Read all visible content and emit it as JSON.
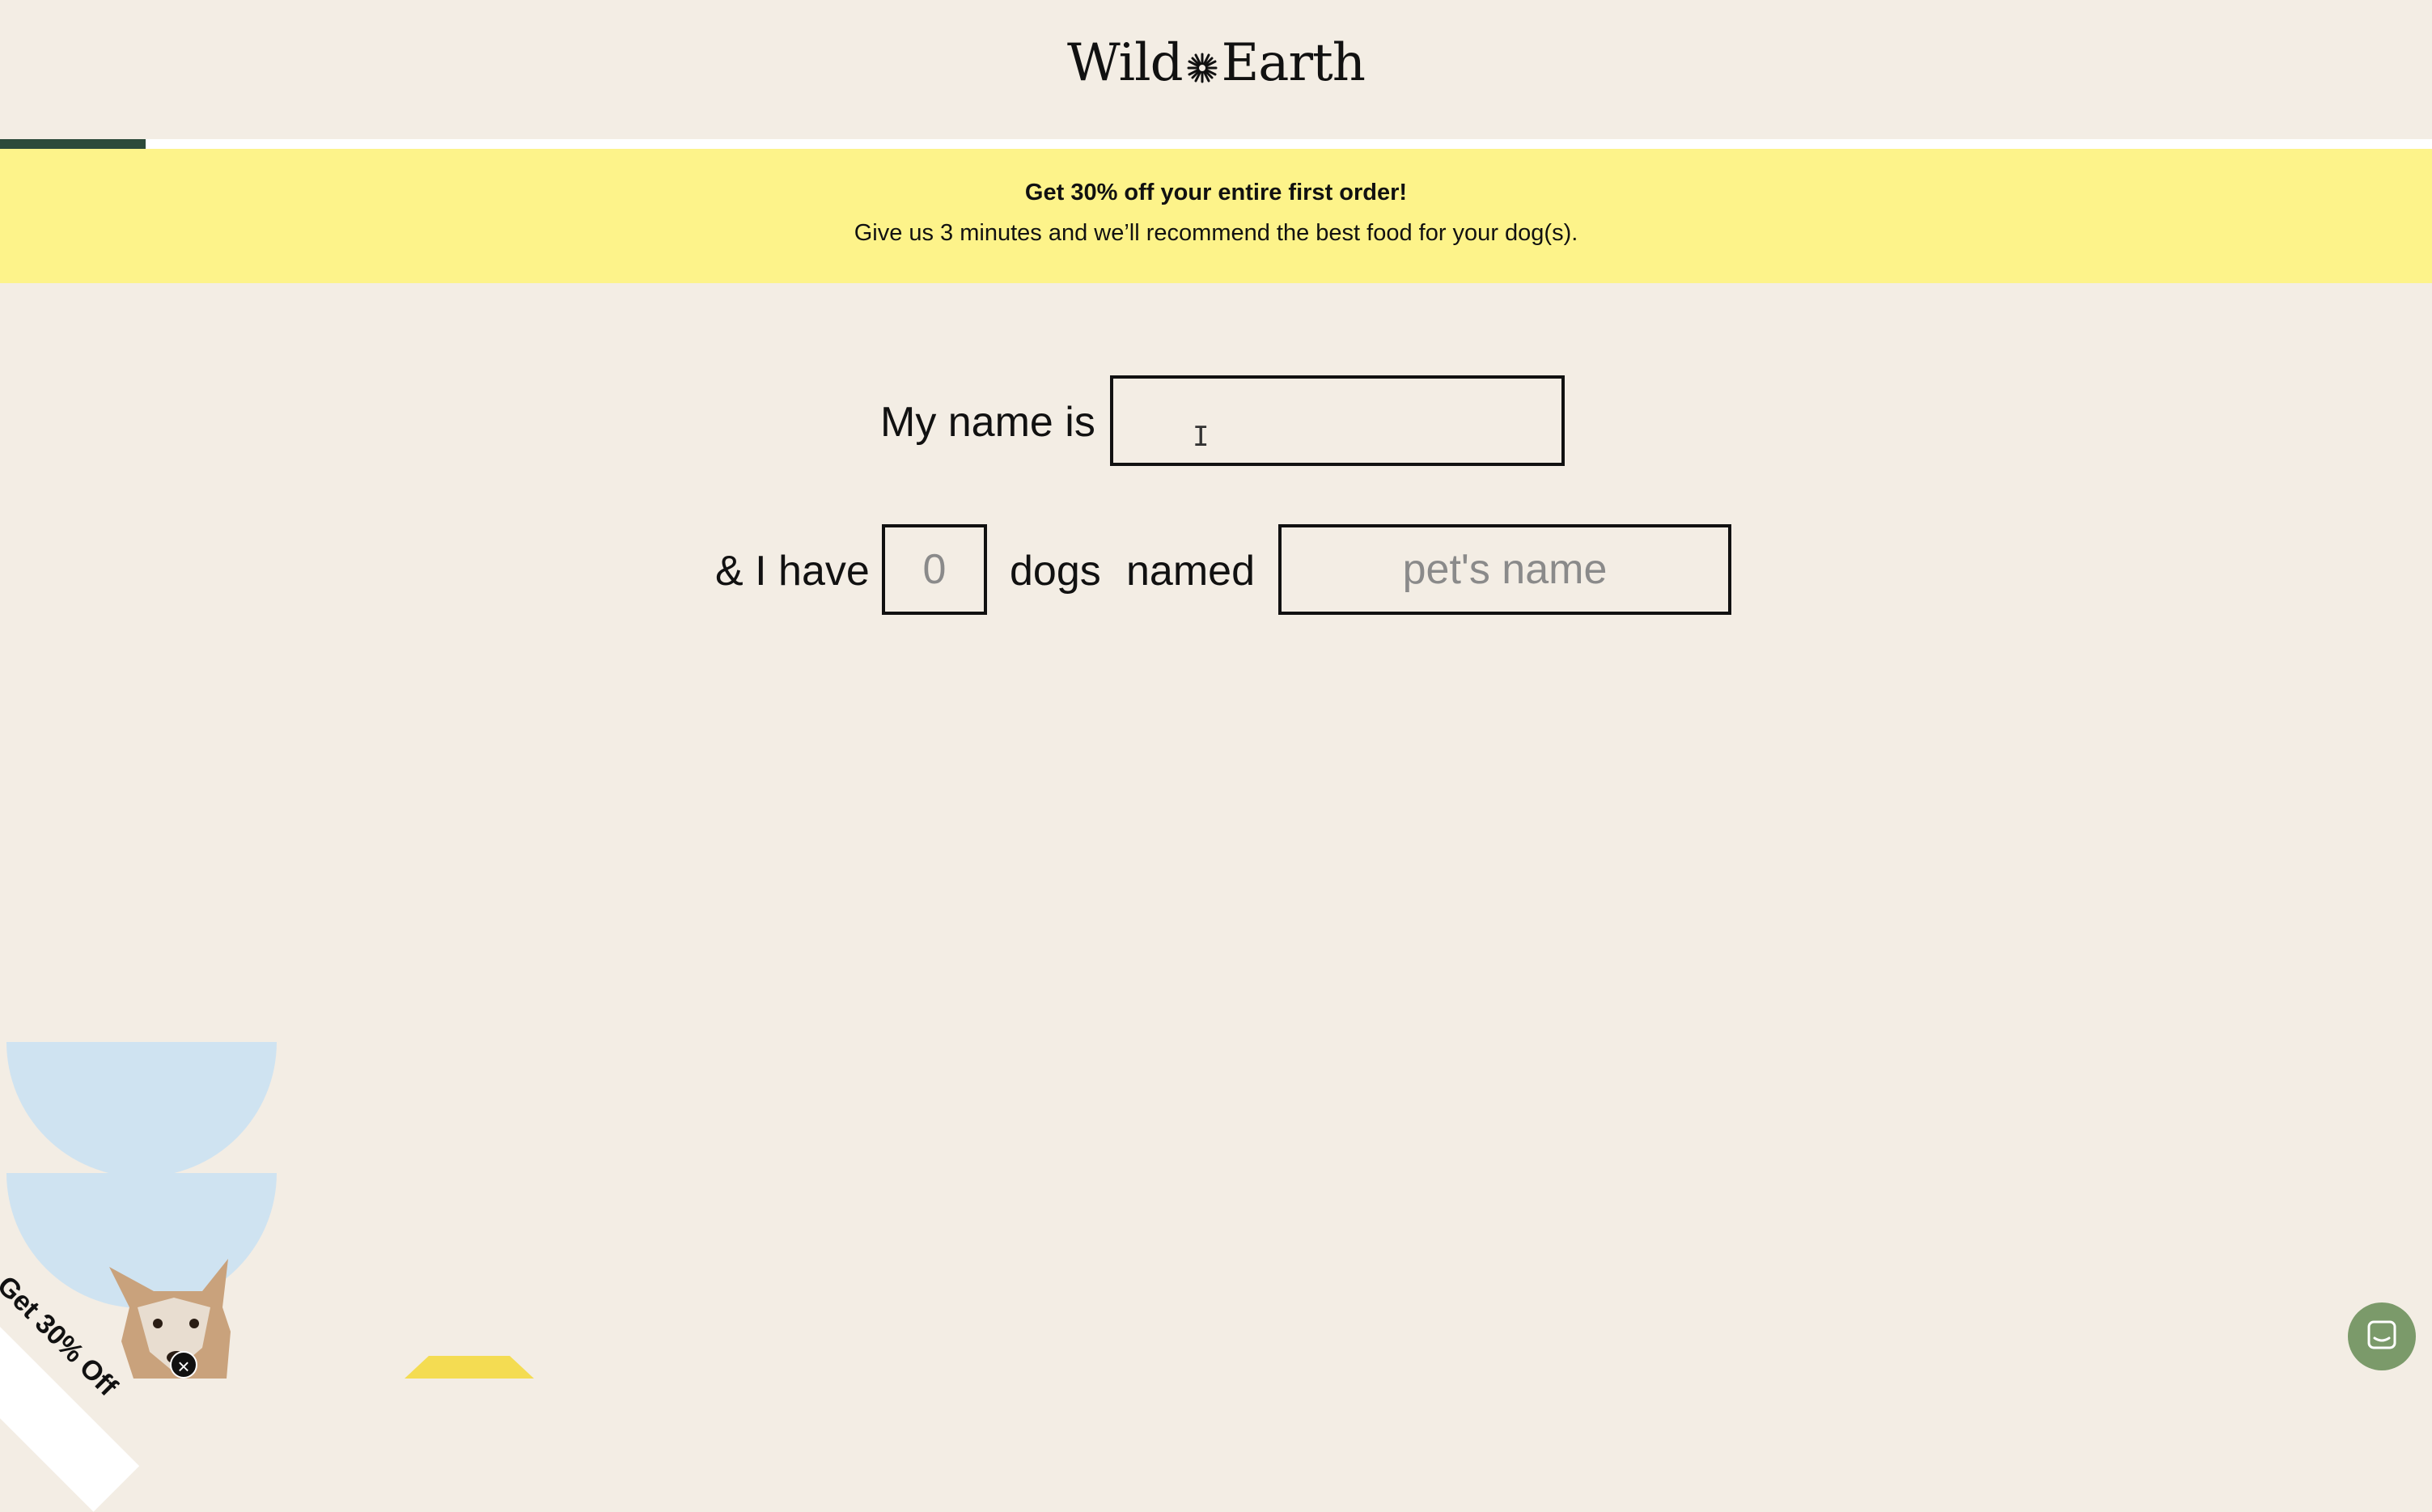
{
  "header": {
    "brand_left": "Wild",
    "brand_right": "Earth",
    "logo_icon": "sun-flower-icon",
    "progress_fraction": 0.06
  },
  "promo": {
    "headline": "Get 30% off your entire first order!",
    "subtext": "Give us 3 minutes and we’ll recommend the best food for your dog(s)."
  },
  "form": {
    "name_label": "My name is",
    "name_value": "",
    "name_placeholder": "",
    "have_label": "& I have",
    "dog_count_placeholder": "0",
    "dogs_label": "dogs",
    "named_label": "named",
    "pet_name_placeholder": "pet's name"
  },
  "corner_offer": {
    "label": "Get 30% Off",
    "close_icon": "close-icon"
  },
  "chat": {
    "icon": "chat-bubble-icon"
  },
  "colors": {
    "background": "#f3ede4",
    "promo_bg": "#fdf38a",
    "progress": "#2d4a3a",
    "deco_blue": "#cfe3f1",
    "deco_yellow": "#f4dc52",
    "chat": "#7b9a6a"
  }
}
